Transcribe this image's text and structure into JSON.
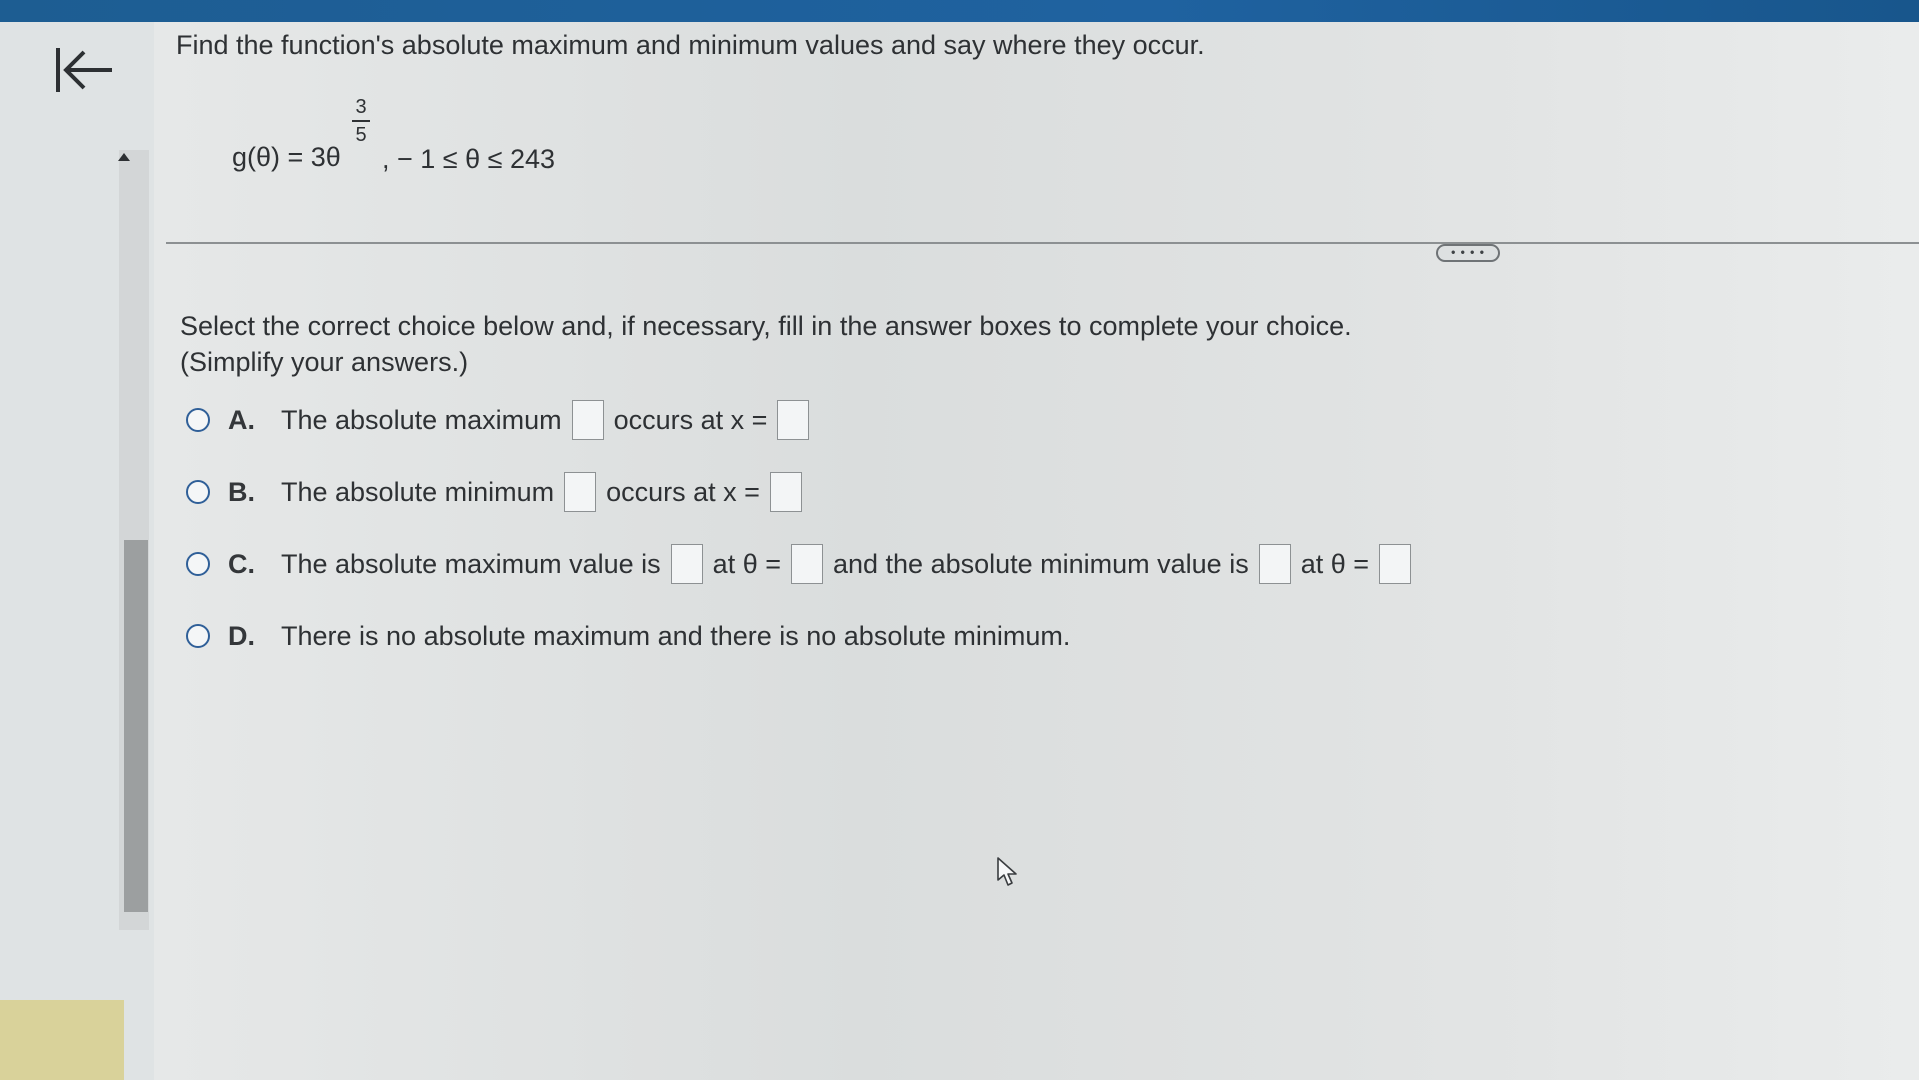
{
  "question": {
    "prompt": "Find the function's absolute maximum and minimum values and say where they occur.",
    "function_lhs": "g(θ) = 3θ",
    "exponent_numerator": "3",
    "exponent_denominator": "5",
    "domain": ",  − 1 ≤ θ ≤ 243"
  },
  "toolbar": {
    "more_label": "• • • •"
  },
  "instructions": {
    "line1": "Select the correct choice below and, if necessary, fill in the answer boxes to complete your choice.",
    "line2": "(Simplify your answers.)"
  },
  "choices": [
    {
      "letter": "A.",
      "text1": "The absolute maximum",
      "text2": "occurs at x ="
    },
    {
      "letter": "B.",
      "text1": "The absolute minimum",
      "text2": "occurs at x ="
    },
    {
      "letter": "C.",
      "text1": "The absolute maximum value is",
      "text2": "at θ =",
      "text3": "and the absolute minimum value is",
      "text4": "at θ ="
    },
    {
      "letter": "D.",
      "text1": "There is no absolute maximum and there is no absolute minimum."
    }
  ],
  "colors": {
    "topbar": "#1d5d92",
    "radio_border": "#2f5f98",
    "text": "#2e3134"
  }
}
